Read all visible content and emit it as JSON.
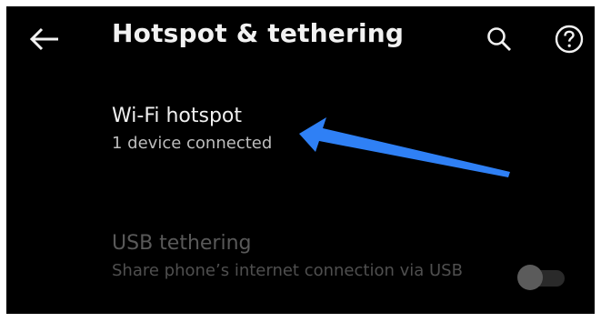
{
  "header": {
    "title": "Hotspot & tethering",
    "back_icon": "arrow-left-icon",
    "search_icon": "search-icon",
    "help_icon": "help-circle-icon"
  },
  "items": {
    "hotspot": {
      "title": "Wi-Fi hotspot",
      "subtitle": "1 device connected"
    },
    "usb": {
      "title": "USB tethering",
      "subtitle": "Share phone’s internet connection via USB",
      "toggle_on": false,
      "disabled": true
    }
  },
  "annotation": {
    "arrow_color": "#2f80f5"
  },
  "colors": {
    "background": "#000000",
    "text_primary": "#f0f0f0",
    "text_secondary": "#bdbdbd",
    "text_disabled": "#595959"
  }
}
